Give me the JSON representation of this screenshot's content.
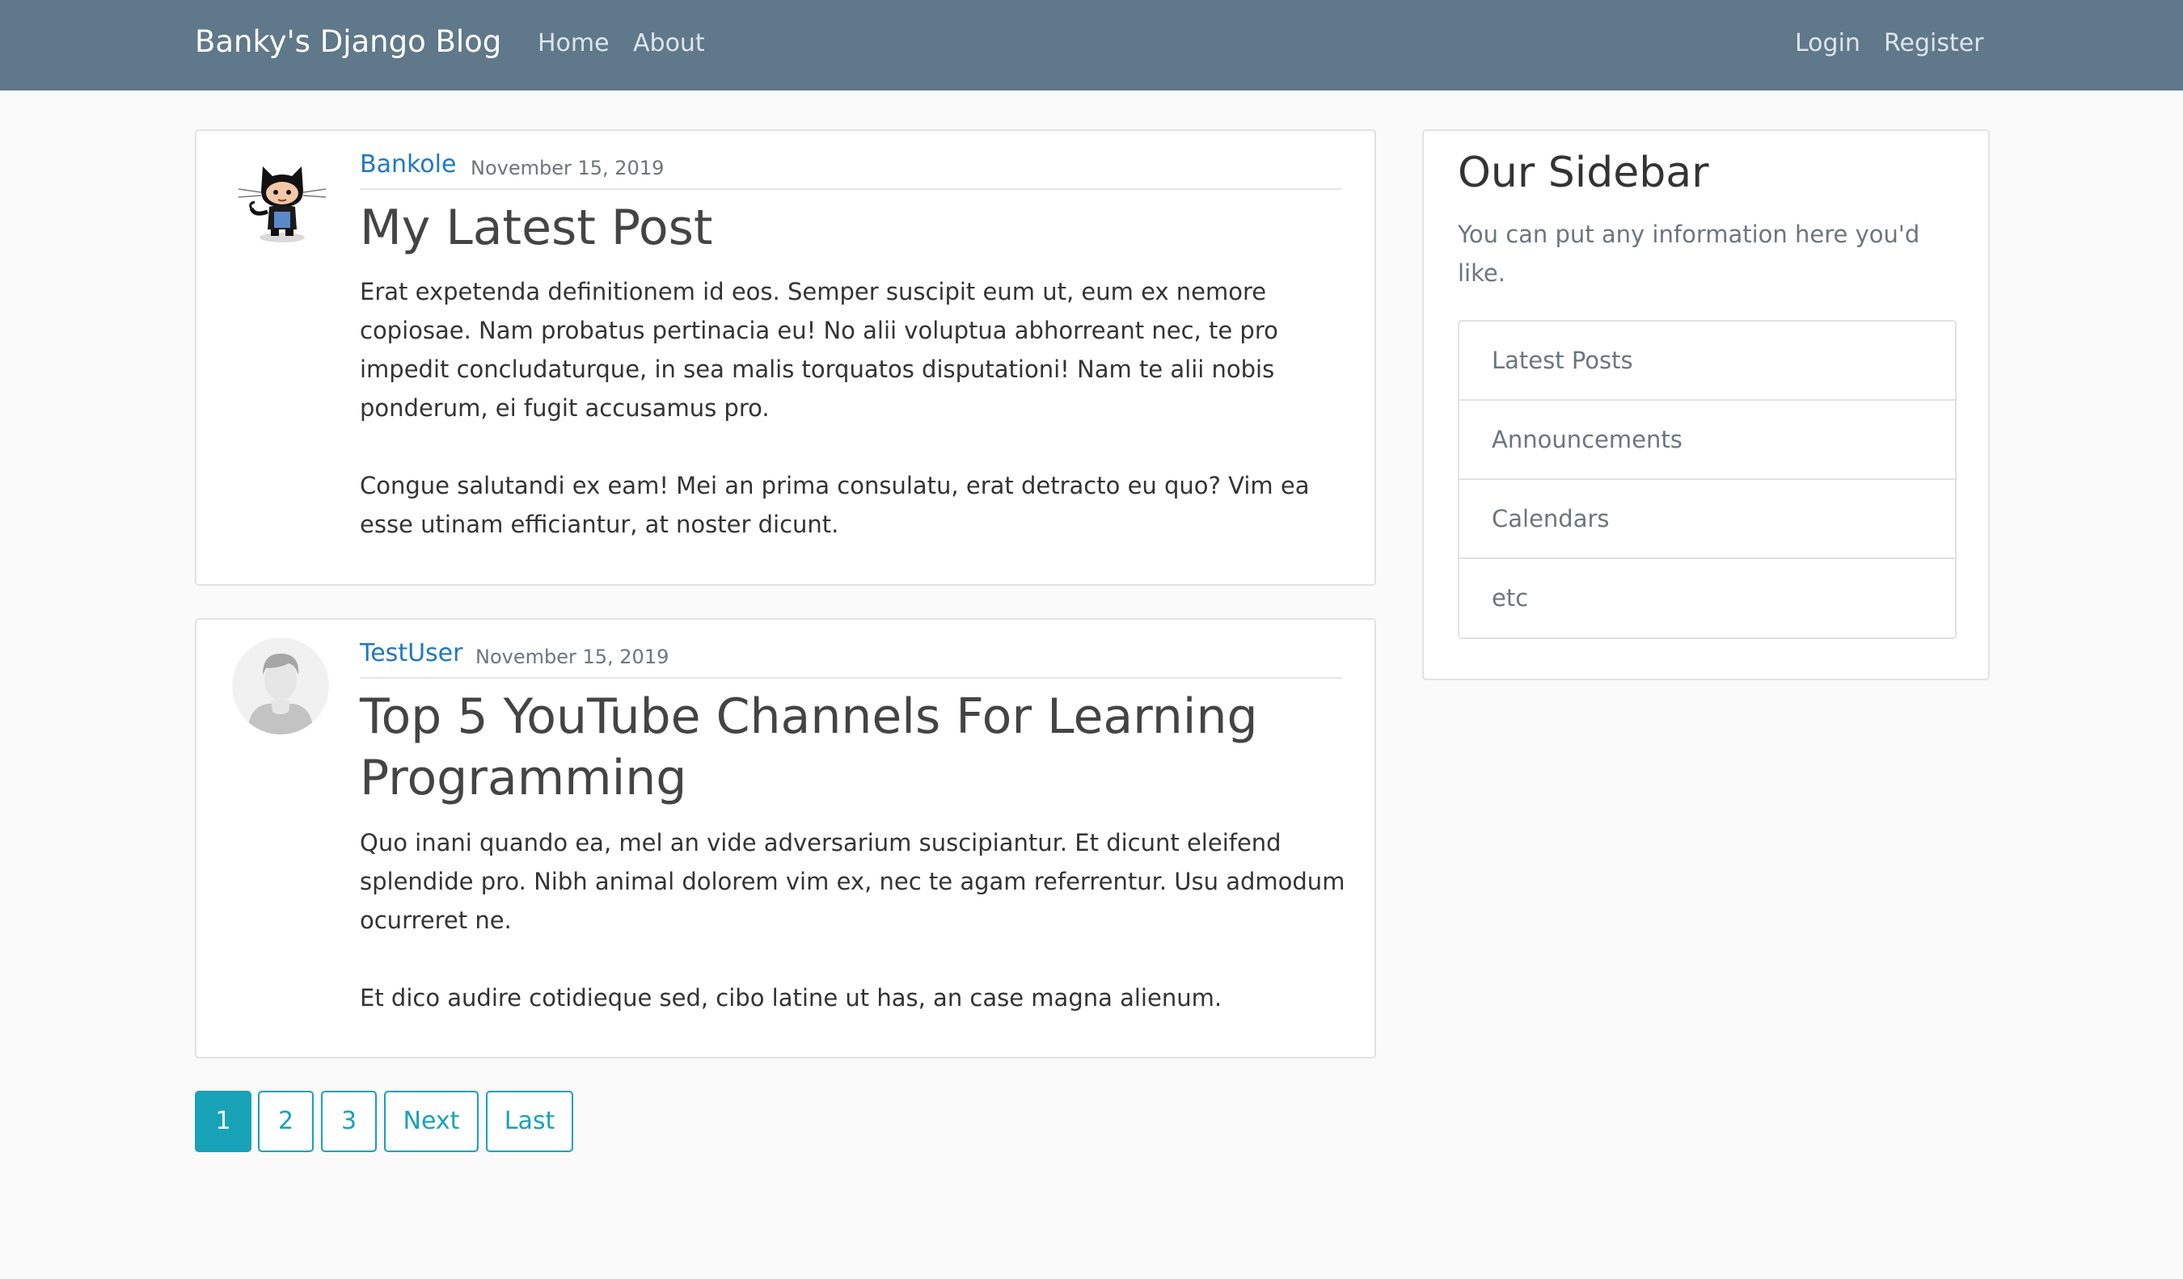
{
  "navbar": {
    "brand": "Banky's Django Blog",
    "left_links": [
      "Home",
      "About"
    ],
    "right_links": [
      "Login",
      "Register"
    ],
    "background": "#5f788a"
  },
  "posts": [
    {
      "author": "Bankole",
      "date": "November 15, 2019",
      "title": "My Latest Post",
      "avatar_icon": "octocat-icon",
      "paragraphs": [
        "Erat expetenda definitionem id eos. Semper suscipit eum ut, eum ex nemore copiosae. Nam probatus pertinacia eu! No alii voluptua abhorreant nec, te pro impedit concludaturque, in sea malis torquatos disputationi! Nam te alii nobis ponderum, ei fugit accusamus pro.",
        "Congue salutandi ex eam! Mei an prima consulatu, erat detracto eu quo? Vim ea esse utinam efficiantur, at noster dicunt."
      ]
    },
    {
      "author": "TestUser",
      "date": "November 15, 2019",
      "title": "Top 5 YouTube Channels For Learning Programming",
      "avatar_icon": "default-user-icon",
      "paragraphs": [
        "Quo inani quando ea, mel an vide adversarium suscipiantur. Et dicunt eleifend splendide pro. Nibh animal dolorem vim ex, nec te agam referrentur. Usu admodum ocurreret ne.",
        "Et dico audire cotidieque sed, cibo latine ut has, an case magna alienum."
      ]
    }
  ],
  "sidebar": {
    "title": "Our Sidebar",
    "description": "You can put any information here you'd like.",
    "items": [
      "Latest Posts",
      "Announcements",
      "Calendars",
      "etc"
    ]
  },
  "pagination": {
    "pages": [
      "1",
      "2",
      "3"
    ],
    "active": "1",
    "next_label": "Next",
    "last_label": "Last",
    "accent": "#17a2b8"
  }
}
